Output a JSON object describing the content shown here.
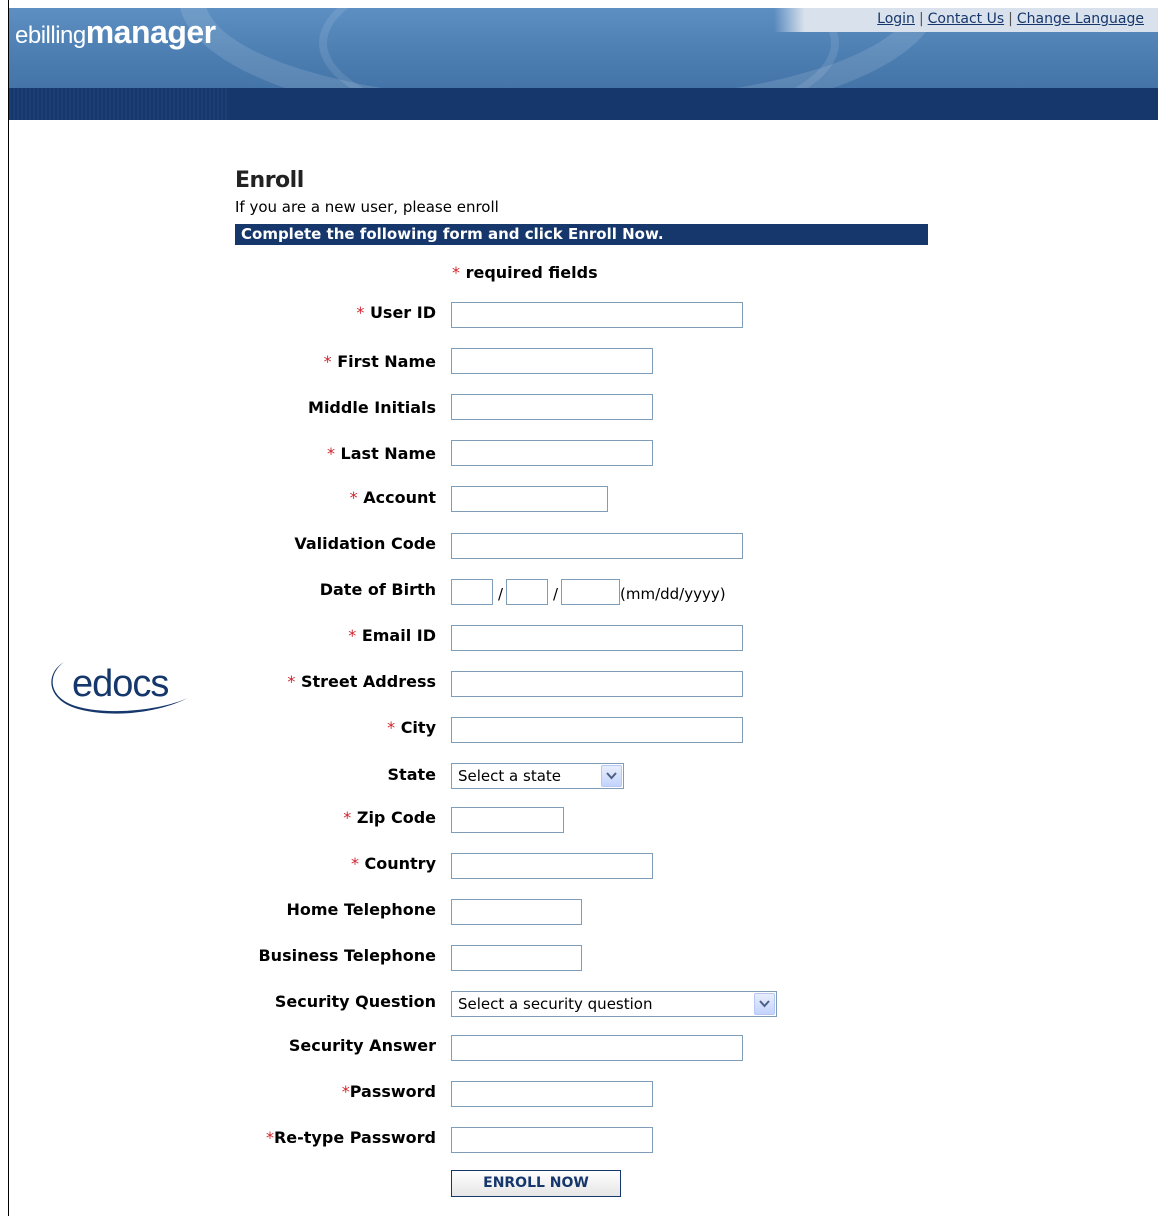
{
  "header": {
    "logo_small": "ebilling",
    "logo_big": "manager",
    "links": {
      "login": "Login",
      "contact": "Contact Us",
      "language": "Change Language",
      "sep": "|"
    }
  },
  "brand": {
    "edocs": "edocs"
  },
  "colors": {
    "navy": "#16376b",
    "header_blue": "#4474a8",
    "required_star": "#d0232b",
    "input_border": "#7f9db9"
  },
  "page": {
    "title": "Enroll",
    "subtitle": "If you are a new user, please enroll",
    "instruction": "Complete the following form and click Enroll Now.",
    "required_note": "required fields",
    "star": "*"
  },
  "fields": {
    "user_id": "User ID",
    "first_name": "First Name",
    "middle_initials": "Middle Initials",
    "last_name": "Last Name",
    "account": "Account",
    "validation_code": "Validation Code",
    "dob": "Date of Birth",
    "dob_sep": "/",
    "dob_format": "(mm/dd/yyyy)",
    "email": "Email ID",
    "street": "Street Address",
    "city": "City",
    "state": "State",
    "state_selected": "Select a state",
    "zip": "Zip Code",
    "country": "Country",
    "home_tel": "Home Telephone",
    "business_tel": "Business Telephone",
    "security_q": "Security Question",
    "security_q_selected": "Select a security question",
    "security_a": "Security Answer",
    "password": "Password",
    "retype_password": "Re-type Password"
  },
  "actions": {
    "enroll": "ENROLL NOW"
  }
}
